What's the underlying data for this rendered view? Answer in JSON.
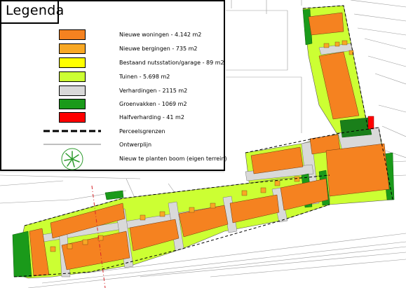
{
  "legend": {
    "title": "Legenda",
    "items": [
      {
        "label": "Nieuwe woningen - 4.142 m2",
        "color": "#f58220"
      },
      {
        "label": "Nieuwe bergingen - 735 m2",
        "color": "#f8a824"
      },
      {
        "label": "Bestaand nutsstation/garage - 89 m2",
        "color": "#ffff00"
      },
      {
        "label": "Tuinen - 5.698 m2",
        "color": "#ccff33"
      },
      {
        "label": "Verhardingen - 2115 m2",
        "color": "#d9d9d9"
      },
      {
        "label": "Groenvakken - 1069 m2",
        "color": "#1a9a1a"
      },
      {
        "label": "Halfverharding - 41 m2",
        "color": "#ff0000"
      }
    ],
    "line_items": [
      {
        "label": "Perceelsgrenzen",
        "icon": "dashed-line-icon"
      },
      {
        "label": "Ontwerplijn",
        "icon": "solid-line-icon"
      },
      {
        "label": "Nieuw te planten boom (eigen terrein)",
        "icon": "tree-icon"
      }
    ]
  },
  "colors": {
    "house": "#f58220",
    "shed": "#f8a824",
    "garden": "#ccff33",
    "paving": "#d9d9d9",
    "green": "#1a9a1a",
    "red": "#ff0000",
    "yellow": "#ffff00",
    "boundary": "#d7252b"
  }
}
